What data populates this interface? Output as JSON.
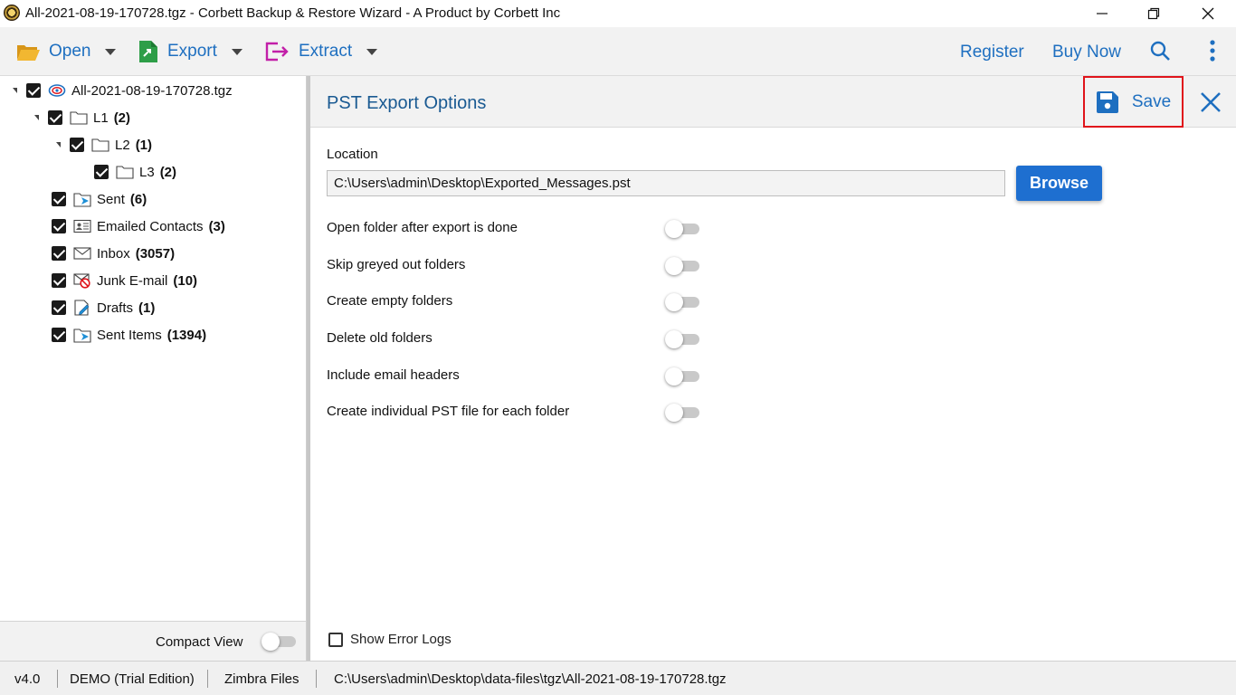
{
  "window": {
    "title": "All-2021-08-19-170728.tgz - Corbett Backup & Restore Wizard - A Product by Corbett Inc"
  },
  "toolbar": {
    "open_label": "Open",
    "export_label": "Export",
    "extract_label": "Extract",
    "register_label": "Register",
    "buy_now_label": "Buy Now"
  },
  "tree": {
    "root": {
      "label": "All-2021-08-19-170728.tgz",
      "checked": true
    },
    "items": [
      {
        "label": "L1",
        "count": "(2)",
        "icon": "folder-icon",
        "checked": true
      },
      {
        "label": "L2",
        "count": "(1)",
        "icon": "folder-icon",
        "checked": true
      },
      {
        "label": "L3",
        "count": "(2)",
        "icon": "folder-icon",
        "checked": true
      },
      {
        "label": "Sent",
        "count": "(6)",
        "icon": "sent-folder-icon",
        "checked": true
      },
      {
        "label": "Emailed Contacts",
        "count": "(3)",
        "icon": "contacts-icon",
        "checked": true
      },
      {
        "label": "Inbox",
        "count": "(3057)",
        "icon": "inbox-icon",
        "checked": true
      },
      {
        "label": "Junk E-mail",
        "count": "(10)",
        "icon": "junk-icon",
        "checked": true
      },
      {
        "label": "Drafts",
        "count": "(1)",
        "icon": "drafts-icon",
        "checked": true
      },
      {
        "label": "Sent Items",
        "count": "(1394)",
        "icon": "sent-folder-icon",
        "checked": true
      }
    ]
  },
  "left_footer": {
    "compact_view_label": "Compact View",
    "compact_view_on": false
  },
  "export_panel": {
    "title": "PST Export Options",
    "save_label": "Save",
    "location_label": "Location",
    "location_value": "C:\\Users\\admin\\Desktop\\Exported_Messages.pst",
    "browse_label": "Browse",
    "options": [
      {
        "label": "Open folder after export is done",
        "on": false
      },
      {
        "label": "Skip greyed out folders",
        "on": false
      },
      {
        "label": "Create empty folders",
        "on": false
      },
      {
        "label": "Delete old folders",
        "on": false
      },
      {
        "label": "Include email headers",
        "on": false
      },
      {
        "label": "Create individual PST file for each folder",
        "on": false
      }
    ],
    "show_error_logs_label": "Show Error Logs",
    "show_error_logs_checked": false
  },
  "statusbar": {
    "version": "v4.0",
    "edition": "DEMO (Trial Edition)",
    "file_type": "Zimbra Files",
    "path": "C:\\Users\\admin\\Desktop\\data-files\\tgz\\All-2021-08-19-170728.tgz"
  },
  "colors": {
    "accent_blue": "#1e6fc0",
    "browse_blue": "#1e6fd0",
    "highlight_red": "#e0141b",
    "export_green": "#2e9e48",
    "extract_magenta": "#c21fa8",
    "open_yellow": "#e5a823"
  }
}
